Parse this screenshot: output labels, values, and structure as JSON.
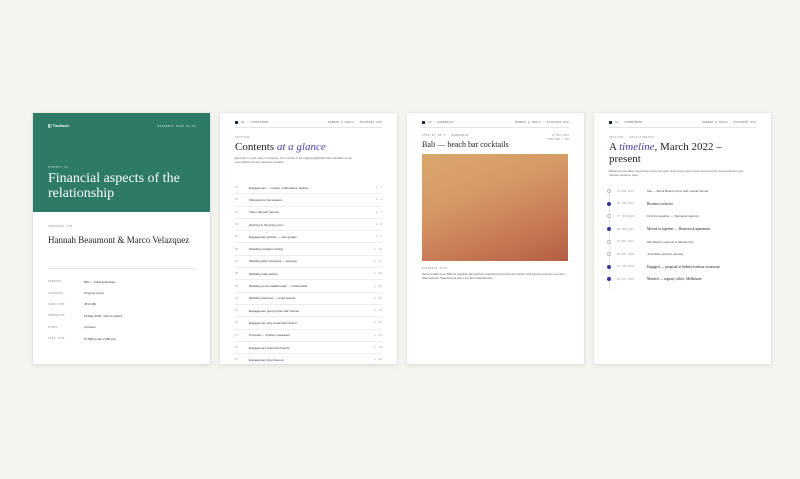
{
  "page1": {
    "logo": "Vaultnote",
    "header_right": "EVIDENCE PACK  01/05",
    "volume": "EXHIBIT 01",
    "title": "Financial aspects of the relationship",
    "prepared_label": "PREPARED FOR",
    "names": "Hannah Beaumont & Marco Velazquez",
    "meta": [
      {
        "k": "PURPOSE",
        "v": "820 — Initial application"
      },
      {
        "k": "COVERAGE",
        "v": "Ongoing (joint)"
      },
      {
        "k": "PAGE SIZE",
        "v": "48 (0-99)"
      },
      {
        "k": "GENERATED",
        "v": "18 May 2026, 4:42 pm AEST"
      },
      {
        "k": "ITEMS",
        "v": "3 photos"
      },
      {
        "k": "FILE SIZE",
        "v": "57 MB (under 2 MB est)"
      }
    ]
  },
  "page2": {
    "header_left": "02 · COMMITMENT",
    "header_right": "HANNAH & MARCO · EVIDENCE 820",
    "section": "SECTION",
    "title_plain": "Contents ",
    "title_italic": "at a glance",
    "sub": "Each item in your pack of evidence. The number in the original applicable item identifies as the case official can see reference uploads.",
    "toc": [
      {
        "n": "01",
        "t": "Engagement — rooftop, champagne, skyline",
        "p": "p. 3"
      },
      {
        "n": "02",
        "t": "Shopping for homewares",
        "p": "p. 4"
      },
      {
        "n": "03",
        "t": "Video call with parents",
        "p": "p. 7"
      },
      {
        "n": "04",
        "t": "Dancing in the living room",
        "p": "p. 8"
      },
      {
        "n": "05",
        "t": "Engagement portrait — rose garden",
        "p": "p. 9"
      },
      {
        "n": "06",
        "t": "Wedding invitation writing",
        "p": "p. 10"
      },
      {
        "n": "07",
        "t": "Wedding attire shopping — lehenga",
        "p": "p. 11"
      },
      {
        "n": "08",
        "t": "Wedding cake tasting",
        "p": "p. 12"
      },
      {
        "n": "09",
        "t": "Wedding venue walkthrough — harbourside",
        "p": "p. 13"
      },
      {
        "n": "10",
        "t": "Wedding planning — mood boards",
        "p": "p. 14"
      },
      {
        "n": "11",
        "t": "Engagement group photo with friends",
        "p": "p. 15"
      },
      {
        "n": "12",
        "t": "Engagement ring reveal after dinner",
        "p": "p. 16"
      },
      {
        "n": "13",
        "t": "Proposal — Sydney restaurant",
        "p": "p. 17"
      },
      {
        "n": "14",
        "t": "Engagement toast with friends",
        "p": "p. 18"
      },
      {
        "n": "15",
        "t": "Engagement ring close-up",
        "p": "p. 19"
      },
      {
        "n": "16",
        "t": "Moving day — pizza on the floor",
        "p": "p. 20"
      },
      {
        "n": "17",
        "t": "First night — candle on the floor",
        "p": "p. 21"
      }
    ]
  },
  "page3": {
    "header_left": "03 · WANDERLUX",
    "header_right": "HANNAH & MARCO · EVIDENCE 820",
    "step": "STEP 03 OF 5 · WANDERLUX",
    "date1": "17 MAY 2023",
    "date2": "ITEM   108 / 352",
    "title": "Bali — beach bar cocktails",
    "cap_label": "EVIDENCE NOTE",
    "caption": "Second night of our Bali trip together. We had been planning this trip for six months, and split the cost from our joint Wise account. Statement at item 17 in the Financial pack."
  },
  "page4": {
    "header_left": "04 · COMMITMENT",
    "header_right": "HANNAH & MARCO · EVIDENCE 820",
    "section": "SECTION · RELATIONSHIP",
    "title_a": "A ",
    "title_italic": "timeline",
    "title_b": ", March 2022 – present",
    "sub": "Milestones are filled; supporting events are open rings. Each event cross-references the best evidence in the relevant evidence pack.",
    "timeline": [
      {
        "d": "11 MAR 2022",
        "e": "Met — Bondi Beach picnic with mutual friends",
        "on": false,
        "b": false
      },
      {
        "d": "02 JUN 2022",
        "e": "Became exclusive",
        "on": true,
        "b": true
      },
      {
        "d": "17 SEP 2022",
        "e": "First trip together — Tasmania road trip",
        "on": false,
        "b": false
      },
      {
        "d": "04 FEB 2023",
        "e": "Moved in together — Brunswick apartment",
        "on": true,
        "b": true
      },
      {
        "d": "15 DEC 2023",
        "e": "Met Marco's parents in Mexico City",
        "on": false,
        "b": false
      },
      {
        "d": "09 MAY 2024",
        "e": "Joint Wise account opened",
        "on": false,
        "b": false
      },
      {
        "d": "21 JUN 2024",
        "e": "Engaged — proposal at Sydney harbour restaurant",
        "on": true,
        "b": true
      },
      {
        "d": "02 MAY 2025",
        "e": "Married — registry office, Melbourne",
        "on": true,
        "b": true
      }
    ]
  }
}
